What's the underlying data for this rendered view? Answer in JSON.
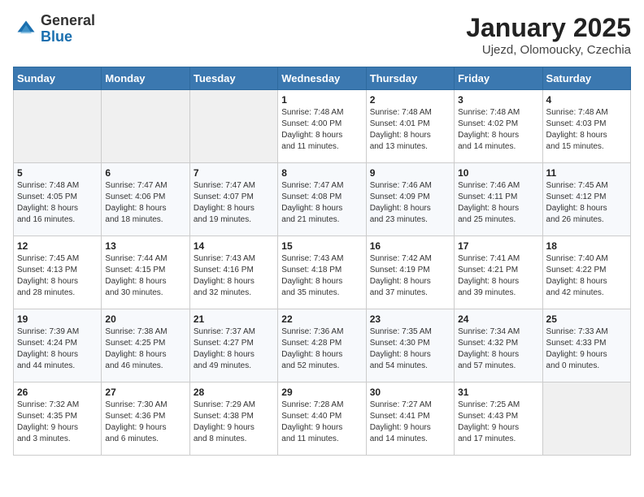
{
  "logo": {
    "general": "General",
    "blue": "Blue"
  },
  "header": {
    "title": "January 2025",
    "subtitle": "Ujezd, Olomoucky, Czechia"
  },
  "days_of_week": [
    "Sunday",
    "Monday",
    "Tuesday",
    "Wednesday",
    "Thursday",
    "Friday",
    "Saturday"
  ],
  "weeks": [
    [
      {
        "day": "",
        "info": ""
      },
      {
        "day": "",
        "info": ""
      },
      {
        "day": "",
        "info": ""
      },
      {
        "day": "1",
        "info": "Sunrise: 7:48 AM\nSunset: 4:00 PM\nDaylight: 8 hours\nand 11 minutes."
      },
      {
        "day": "2",
        "info": "Sunrise: 7:48 AM\nSunset: 4:01 PM\nDaylight: 8 hours\nand 13 minutes."
      },
      {
        "day": "3",
        "info": "Sunrise: 7:48 AM\nSunset: 4:02 PM\nDaylight: 8 hours\nand 14 minutes."
      },
      {
        "day": "4",
        "info": "Sunrise: 7:48 AM\nSunset: 4:03 PM\nDaylight: 8 hours\nand 15 minutes."
      }
    ],
    [
      {
        "day": "5",
        "info": "Sunrise: 7:48 AM\nSunset: 4:05 PM\nDaylight: 8 hours\nand 16 minutes."
      },
      {
        "day": "6",
        "info": "Sunrise: 7:47 AM\nSunset: 4:06 PM\nDaylight: 8 hours\nand 18 minutes."
      },
      {
        "day": "7",
        "info": "Sunrise: 7:47 AM\nSunset: 4:07 PM\nDaylight: 8 hours\nand 19 minutes."
      },
      {
        "day": "8",
        "info": "Sunrise: 7:47 AM\nSunset: 4:08 PM\nDaylight: 8 hours\nand 21 minutes."
      },
      {
        "day": "9",
        "info": "Sunrise: 7:46 AM\nSunset: 4:09 PM\nDaylight: 8 hours\nand 23 minutes."
      },
      {
        "day": "10",
        "info": "Sunrise: 7:46 AM\nSunset: 4:11 PM\nDaylight: 8 hours\nand 25 minutes."
      },
      {
        "day": "11",
        "info": "Sunrise: 7:45 AM\nSunset: 4:12 PM\nDaylight: 8 hours\nand 26 minutes."
      }
    ],
    [
      {
        "day": "12",
        "info": "Sunrise: 7:45 AM\nSunset: 4:13 PM\nDaylight: 8 hours\nand 28 minutes."
      },
      {
        "day": "13",
        "info": "Sunrise: 7:44 AM\nSunset: 4:15 PM\nDaylight: 8 hours\nand 30 minutes."
      },
      {
        "day": "14",
        "info": "Sunrise: 7:43 AM\nSunset: 4:16 PM\nDaylight: 8 hours\nand 32 minutes."
      },
      {
        "day": "15",
        "info": "Sunrise: 7:43 AM\nSunset: 4:18 PM\nDaylight: 8 hours\nand 35 minutes."
      },
      {
        "day": "16",
        "info": "Sunrise: 7:42 AM\nSunset: 4:19 PM\nDaylight: 8 hours\nand 37 minutes."
      },
      {
        "day": "17",
        "info": "Sunrise: 7:41 AM\nSunset: 4:21 PM\nDaylight: 8 hours\nand 39 minutes."
      },
      {
        "day": "18",
        "info": "Sunrise: 7:40 AM\nSunset: 4:22 PM\nDaylight: 8 hours\nand 42 minutes."
      }
    ],
    [
      {
        "day": "19",
        "info": "Sunrise: 7:39 AM\nSunset: 4:24 PM\nDaylight: 8 hours\nand 44 minutes."
      },
      {
        "day": "20",
        "info": "Sunrise: 7:38 AM\nSunset: 4:25 PM\nDaylight: 8 hours\nand 46 minutes."
      },
      {
        "day": "21",
        "info": "Sunrise: 7:37 AM\nSunset: 4:27 PM\nDaylight: 8 hours\nand 49 minutes."
      },
      {
        "day": "22",
        "info": "Sunrise: 7:36 AM\nSunset: 4:28 PM\nDaylight: 8 hours\nand 52 minutes."
      },
      {
        "day": "23",
        "info": "Sunrise: 7:35 AM\nSunset: 4:30 PM\nDaylight: 8 hours\nand 54 minutes."
      },
      {
        "day": "24",
        "info": "Sunrise: 7:34 AM\nSunset: 4:32 PM\nDaylight: 8 hours\nand 57 minutes."
      },
      {
        "day": "25",
        "info": "Sunrise: 7:33 AM\nSunset: 4:33 PM\nDaylight: 9 hours\nand 0 minutes."
      }
    ],
    [
      {
        "day": "26",
        "info": "Sunrise: 7:32 AM\nSunset: 4:35 PM\nDaylight: 9 hours\nand 3 minutes."
      },
      {
        "day": "27",
        "info": "Sunrise: 7:30 AM\nSunset: 4:36 PM\nDaylight: 9 hours\nand 6 minutes."
      },
      {
        "day": "28",
        "info": "Sunrise: 7:29 AM\nSunset: 4:38 PM\nDaylight: 9 hours\nand 8 minutes."
      },
      {
        "day": "29",
        "info": "Sunrise: 7:28 AM\nSunset: 4:40 PM\nDaylight: 9 hours\nand 11 minutes."
      },
      {
        "day": "30",
        "info": "Sunrise: 7:27 AM\nSunset: 4:41 PM\nDaylight: 9 hours\nand 14 minutes."
      },
      {
        "day": "31",
        "info": "Sunrise: 7:25 AM\nSunset: 4:43 PM\nDaylight: 9 hours\nand 17 minutes."
      },
      {
        "day": "",
        "info": ""
      }
    ]
  ]
}
